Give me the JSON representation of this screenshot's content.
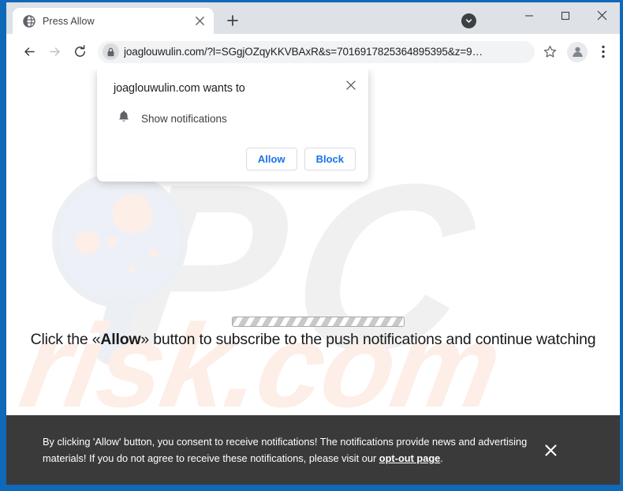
{
  "window": {
    "controls": {
      "minimize": "minimize-icon",
      "maximize": "maximize-icon",
      "close": "close-icon"
    },
    "frame_color": "#1068b8"
  },
  "browser": {
    "tab_strip_color": "#dee1e6",
    "tabs": [
      {
        "title": "Press Allow",
        "favicon": "globe-icon",
        "close_label": "×",
        "active": true
      }
    ],
    "new_tab_label": "+",
    "download_badge": "chevron-down-circle-icon",
    "toolbar": {
      "back": "back-arrow-icon",
      "forward": "forward-arrow-icon",
      "reload": "reload-icon",
      "lock": "lock-icon",
      "url": "joaglouwulin.com/?l=SGgjOZqyKKVBAxR&s=7016917825364895395&z=9…",
      "bookmark": "star-icon",
      "profile": "avatar-icon",
      "menu": "three-dot-menu-icon"
    }
  },
  "dialog": {
    "title": "joaglouwulin.com wants to",
    "close_label": "✕",
    "permission_icon": "bell-icon",
    "permission_label": "Show notifications",
    "allow_label": "Allow",
    "block_label": "Block",
    "accent_color": "#1a73e8"
  },
  "page": {
    "instruction_before": "Click the «Allow»",
    "instruction_bold": "Allow",
    "instruction_prefix": "Click the «",
    "instruction_suffix": "» button to subscribe to the push notifications and continue watching",
    "progress_bar": "striped-progress-bar",
    "watermark_pc": "PC",
    "watermark_risk": "risk.com"
  },
  "consent_banner": {
    "text_part1": "By clicking 'Allow' button, you consent to receive notifications! The notifications provide news and advertising materials! If you do not agree to receive these notifications, please visit our ",
    "link_label": "opt-out page",
    "text_part2": ".",
    "close_label": "✕",
    "background_color": "#3a3a3a"
  }
}
